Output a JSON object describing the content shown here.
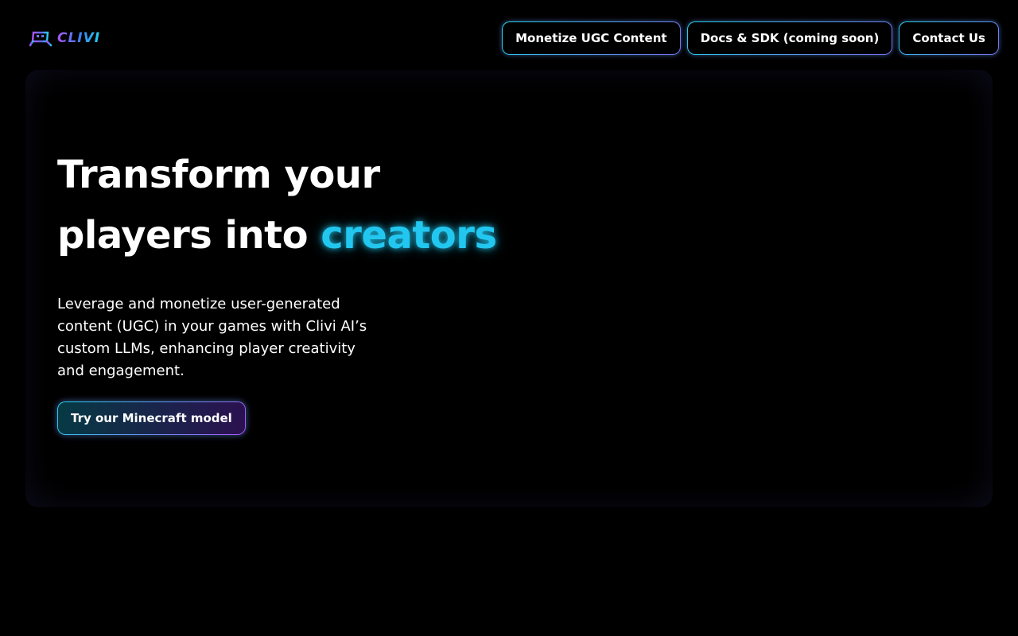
{
  "header": {
    "logo_text": "CLIVI",
    "logo_icon": "gamepad-icon",
    "nav": [
      {
        "label": "Monetize UGC Content"
      },
      {
        "label": "Docs & SDK (coming soon)"
      },
      {
        "label": "Contact Us"
      }
    ]
  },
  "hero": {
    "title_line1": "Transform your",
    "title_line2_prefix": "players into ",
    "title_highlight": "creators",
    "description": "Leverage and monetize user-generated content (UGC) in your games with Clivi AI’s custom LLMs, enhancing player creativity and engagement.",
    "cta_label": "Try our Minecraft model"
  },
  "colors": {
    "background": "#000000",
    "accent_cyan": "#22c7f0",
    "accent_purple": "#a855f7",
    "card_bg": "#0c0b1a"
  }
}
